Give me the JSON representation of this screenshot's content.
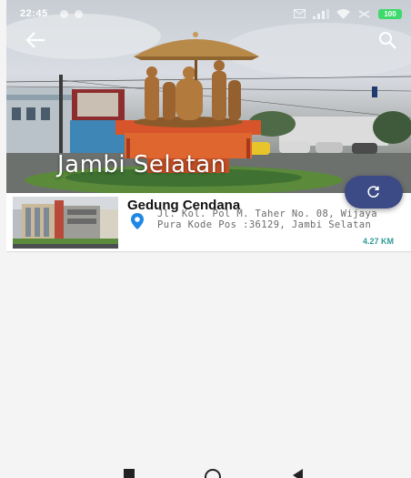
{
  "status_bar": {
    "time": "22:45",
    "battery": "100",
    "icons": [
      "notification-dot-icon",
      "notification-dot-icon",
      "mail-icon",
      "signal-icon",
      "wifi-icon",
      "bluetooth-icon",
      "battery-icon"
    ]
  },
  "header": {
    "title": "Jambi Selatan",
    "back_icon": "arrow-left-icon",
    "search_icon": "search-icon"
  },
  "fab": {
    "icon": "refresh-icon",
    "color": "#3c4a86"
  },
  "places": [
    {
      "name": "Gedung Cendana",
      "address": "Jl. Kol. Pol M. Taher No. 08, Wijaya Pura Kode Pos :36129, Jambi Selatan",
      "distance": "4.27 KM",
      "pin_color": "#1e88e5",
      "distance_color": "#2f9a97"
    }
  ],
  "nav_bar": {
    "icons": [
      "recents-icon",
      "home-icon",
      "back-icon"
    ]
  }
}
